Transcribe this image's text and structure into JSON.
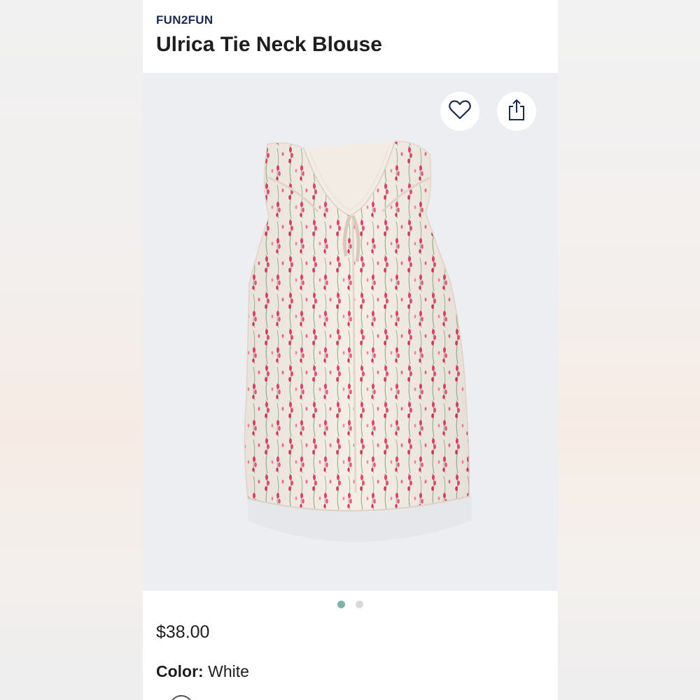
{
  "product": {
    "brand": "FUN2FUN",
    "title": "Ulrica Tie Neck Blouse",
    "price": "$38.00",
    "color_label": "Color:",
    "color_value": "White"
  },
  "actions": {
    "favorite_icon": "heart-icon",
    "share_icon": "share-icon"
  },
  "gallery": {
    "image_count": 2,
    "active_index": 0
  },
  "colors": {
    "brand_text": "#1d2a4d",
    "active_dot": "#7fb3a6",
    "inactive_dot": "#d9d9d9",
    "photo_bg": "#edeef1"
  }
}
